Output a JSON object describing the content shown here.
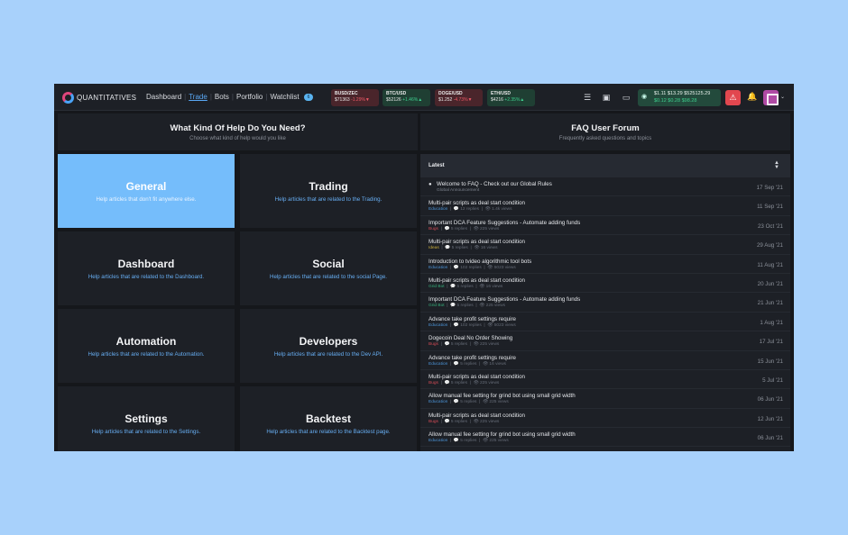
{
  "brand": {
    "name": "QUANTITATIVES"
  },
  "nav": {
    "items": [
      "Dashboard",
      "Trade",
      "Bots",
      "Portfolio",
      "Watchlist"
    ],
    "active": "Trade",
    "watchlist_count": "6"
  },
  "tickers": [
    {
      "symbol": "BUSD/ZEC",
      "price": "$71363",
      "change": "-1.29%",
      "arrow": "▼",
      "direction": "down"
    },
    {
      "symbol": "BTC/USD",
      "price": "$52126",
      "change": "+1.46%",
      "arrow": "▲",
      "direction": "up"
    },
    {
      "symbol": "DOGE/USD",
      "price": "$1.252",
      "change": "-4.73%",
      "arrow": "▼",
      "direction": "down"
    },
    {
      "symbol": "ETH/USD",
      "price": "$4216",
      "change": "+2.35%",
      "arrow": "▲",
      "direction": "up"
    }
  ],
  "balance": {
    "top": "$1.11  $13.29  $525125.29",
    "bottom": "$0.12  $0.28    $98.28"
  },
  "help": {
    "title": "What Kind Of Help Do You Need?",
    "subtitle": "Choose what kind of help would you like"
  },
  "categories": [
    {
      "title": "General",
      "desc": "Help articles that don't fit anywhere else."
    },
    {
      "title": "Trading",
      "desc": "Help articles that are related to the Trading."
    },
    {
      "title": "Dashboard",
      "desc": "Help articles that are related to the Dashboard."
    },
    {
      "title": "Social",
      "desc": "Help articles that are related to the social Page."
    },
    {
      "title": "Automation",
      "desc": "Help articles that are related to the Automation."
    },
    {
      "title": "Developers",
      "desc": "Help articles that are related to the Dev API."
    },
    {
      "title": "Settings",
      "desc": "Help articles that are related to the Settings."
    },
    {
      "title": "Backtest",
      "desc": "Help articles that are related to the Backtest page."
    }
  ],
  "forum": {
    "title": "FAQ User Forum",
    "subtitle": "Frequently asked questions and topics",
    "list_label": "Latest",
    "topics": [
      {
        "title": "Welcome to FAQ - Check out our Global Rules",
        "category": "Global Announcement",
        "cat_class": "ann",
        "replies": "",
        "views": "",
        "date": "17 Sep '21",
        "pinned": true
      },
      {
        "title": "Multi-pair scripts as deal start condition",
        "category": "Education",
        "cat_class": "edu",
        "replies": "12 replies",
        "views": "1.4k views",
        "date": "11 Sep '21"
      },
      {
        "title": "Important DCA Feature Suggestions - Automate adding funds",
        "category": "Bugs",
        "cat_class": "bugs",
        "replies": "5 replies",
        "views": "225 views",
        "date": "23 Oct '21"
      },
      {
        "title": "Multi-pair scripts as deal start condition",
        "category": "Ideas",
        "cat_class": "ideas",
        "replies": "5 replies",
        "views": "16 views",
        "date": "29 Aug '21"
      },
      {
        "title": "Introduction to tvideo algorithmic tool bots",
        "category": "Education",
        "cat_class": "edu",
        "replies": "102 replies",
        "views": "5023 views",
        "date": "11 Aug '21"
      },
      {
        "title": "Multi-pair scripts as deal start condition",
        "category": "Grid Bot",
        "cat_class": "grid",
        "replies": "5 replies",
        "views": "16 views",
        "date": "20 Jun '21"
      },
      {
        "title": "Important DCA Feature Suggestions - Automate adding funds",
        "category": "Grid Bot",
        "cat_class": "grid",
        "replies": "5 replies",
        "views": "225 views",
        "date": "21 Jun '21"
      },
      {
        "title": "Advance take profit settings require",
        "category": "Education",
        "cat_class": "edu",
        "replies": "102 replies",
        "views": "5023 views",
        "date": "1 Aug '21"
      },
      {
        "title": "Dogecoin Deal No Order Showing",
        "category": "Bugs",
        "cat_class": "bugs",
        "replies": "5 replies",
        "views": "225 views",
        "date": "17 Jul '21"
      },
      {
        "title": "Advance take profit settings require",
        "category": "Education",
        "cat_class": "edu",
        "replies": "5 replies",
        "views": "16 views",
        "date": "15 Jun '21"
      },
      {
        "title": "Multi-pair scripts as deal start condition",
        "category": "Bugs",
        "cat_class": "bugs",
        "replies": "5 replies",
        "views": "225 views",
        "date": "5 Jul '21"
      },
      {
        "title": "Allow manual fee setting for grind bot using small grid width",
        "category": "Education",
        "cat_class": "edu",
        "replies": "5 replies",
        "views": "225 views",
        "date": "06 Jun '21"
      },
      {
        "title": "Multi-pair scripts as deal start condition",
        "category": "Bugs",
        "cat_class": "bugs",
        "replies": "5 replies",
        "views": "225 views",
        "date": "12 Jun '21"
      },
      {
        "title": "Allow manual fee setting for grind bot using small grid width",
        "category": "Education",
        "cat_class": "edu",
        "replies": "5 replies",
        "views": "225 views",
        "date": "06 Jun '21"
      }
    ]
  }
}
